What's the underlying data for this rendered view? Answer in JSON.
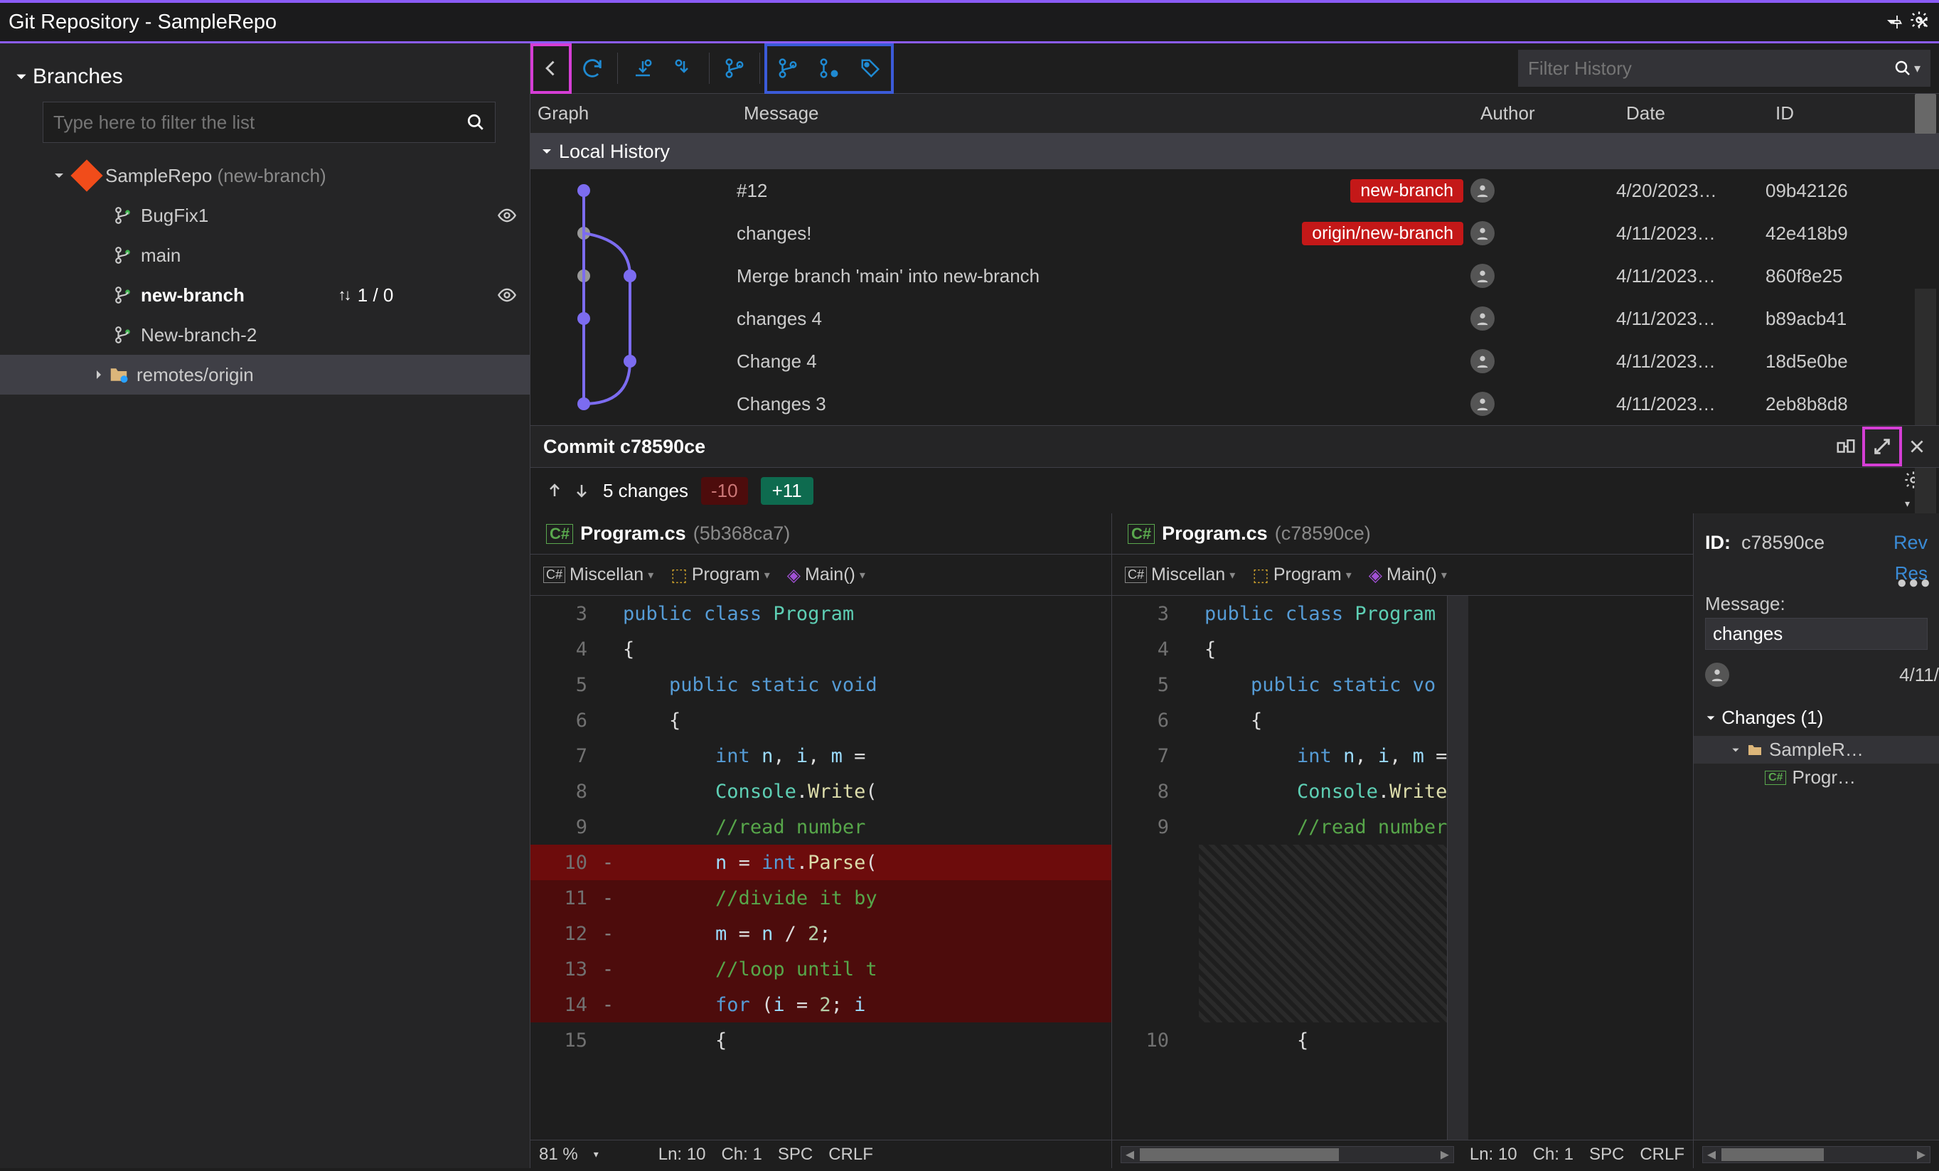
{
  "titlebar": {
    "text": "Git Repository - SampleRepo"
  },
  "sidebar": {
    "section": "Branches",
    "filter_placeholder": "Type here to filter the list",
    "repo": {
      "name": "SampleRepo",
      "current": "(new-branch)"
    },
    "branches": [
      {
        "name": "BugFix1",
        "current": false
      },
      {
        "name": "main",
        "current": false
      },
      {
        "name": "new-branch",
        "current": true,
        "tracking": "1 / 0"
      },
      {
        "name": "New-branch-2",
        "current": false
      }
    ],
    "remotes_label": "remotes/origin"
  },
  "history": {
    "filter_placeholder": "Filter History",
    "columns": {
      "graph": "Graph",
      "message": "Message",
      "author": "Author",
      "date": "Date",
      "id": "ID"
    },
    "section": "Local History",
    "commits": [
      {
        "msg": "#12",
        "badge": "new-branch",
        "badge_cls": "badge-red",
        "date": "4/20/2023…",
        "id": "09b42126"
      },
      {
        "msg": "changes!",
        "badge": "origin/new-branch",
        "badge_cls": "badge-red",
        "date": "4/11/2023…",
        "id": "42e418b9"
      },
      {
        "msg": "Merge branch 'main' into new-branch",
        "date": "4/11/2023…",
        "id": "860f8e25"
      },
      {
        "msg": "changes 4",
        "date": "4/11/2023…",
        "id": "b89acb41"
      },
      {
        "msg": "Change 4",
        "date": "4/11/2023…",
        "id": "18d5e0be"
      },
      {
        "msg": "Changes 3",
        "date": "4/11/2023…",
        "id": "2eb8b8d8"
      }
    ]
  },
  "commit_detail": {
    "title_prefix": "Commit ",
    "hash": "c78590ce",
    "changes_label": "5 changes",
    "deletions": "-10",
    "additions": "+11",
    "left_file": {
      "name": "Program.cs",
      "rev": "(5b368ca7)"
    },
    "right_file": {
      "name": "Program.cs",
      "rev": "(c78590ce)"
    },
    "nav": {
      "proj": "Miscellan",
      "ns": "Program",
      "member": "Main()"
    },
    "left_zoom": "81 %",
    "status": {
      "ln": "Ln: 10",
      "ch": "Ch: 1",
      "spc": "SPC",
      "crlf": "CRLF"
    }
  },
  "code_left": [
    {
      "n": "3",
      "html": "<span class='kw'>public</span> <span class='kw'>class</span> <span class='cls'>Program</span>",
      "cls": "",
      "marker": ""
    },
    {
      "n": "4",
      "html": "<span class='plain'>{</span>",
      "cls": "",
      "marker": ""
    },
    {
      "n": "5",
      "html": "    <span class='kw'>public</span> <span class='kw'>static</span> <span class='kw'>void</span>",
      "cls": "",
      "marker": ""
    },
    {
      "n": "6",
      "html": "    <span class='plain'>{</span>",
      "cls": "",
      "marker": ""
    },
    {
      "n": "7",
      "html": "        <span class='kw'>int</span> <span class='ident'>n</span><span class='plain'>, </span><span class='ident'>i</span><span class='plain'>, </span><span class='ident'>m</span><span class='plain'> = </span>",
      "cls": "",
      "marker": ""
    },
    {
      "n": "8",
      "html": "        <span class='cls'>Console</span><span class='plain'>.</span><span class='fn'>Write</span><span class='plain'>(</span>",
      "cls": "",
      "marker": ""
    },
    {
      "n": "9",
      "html": "        <span class='cmt'>//read number </span>",
      "cls": "",
      "marker": ""
    },
    {
      "n": "10",
      "html": "        <span class='ident'>n</span><span class='plain'> = </span><span class='kw'>int</span><span class='plain'>.</span><span class='fn'>Parse</span><span class='plain'>(</span>",
      "cls": "deleted-line-strong",
      "marker": "-"
    },
    {
      "n": "11",
      "html": "        <span class='cmt'>//divide it by</span>",
      "cls": "deleted-line",
      "marker": "-"
    },
    {
      "n": "12",
      "html": "        <span class='ident'>m</span><span class='plain'> = </span><span class='ident'>n</span><span class='plain'> / </span><span class='num'>2</span><span class='plain'>;</span>",
      "cls": "deleted-line",
      "marker": "-"
    },
    {
      "n": "13",
      "html": "        <span class='cmt'>//loop until t</span>",
      "cls": "deleted-line",
      "marker": "-"
    },
    {
      "n": "14",
      "html": "        <span class='kw'>for</span><span class='plain'> (</span><span class='ident'>i</span><span class='plain'> = </span><span class='num'>2</span><span class='plain'>; </span><span class='ident'>i</span>",
      "cls": "deleted-line",
      "marker": "-"
    },
    {
      "n": "15",
      "html": "        <span class='plain'>{</span>",
      "cls": "",
      "marker": ""
    }
  ],
  "code_right": [
    {
      "n": "3",
      "html": "<span class='kw'>public</span> <span class='kw'>class</span> <span class='cls'>Program</span>",
      "marker": ""
    },
    {
      "n": "4",
      "html": "<span class='plain'>{</span>",
      "marker": ""
    },
    {
      "n": "5",
      "html": "    <span class='kw'>public</span> <span class='kw'>static</span> <span class='kw'>vo</span>",
      "marker": ""
    },
    {
      "n": "6",
      "html": "    <span class='plain'>{</span>",
      "marker": ""
    },
    {
      "n": "7",
      "html": "        <span class='kw'>int</span> <span class='ident'>n</span><span class='plain'>, </span><span class='ident'>i</span><span class='plain'>, </span><span class='ident'>m</span><span class='plain'> =</span>",
      "marker": ""
    },
    {
      "n": "8",
      "html": "        <span class='cls'>Console</span><span class='plain'>.</span><span class='fn'>Write</span>",
      "marker": ""
    },
    {
      "n": "9",
      "html": "        <span class='cmt'>//read number</span>",
      "marker": ""
    }
  ],
  "right_gutter_after": "10",
  "detail": {
    "id_label": "ID:",
    "id_val": "c78590ce",
    "rev_link": "Rev",
    "res_link": "Res",
    "msg_label": "Message:",
    "msg_val": "changes",
    "date": "4/11/",
    "changes_hdr": "Changes (1)",
    "folder": "SampleR…",
    "file": "Progr…"
  }
}
